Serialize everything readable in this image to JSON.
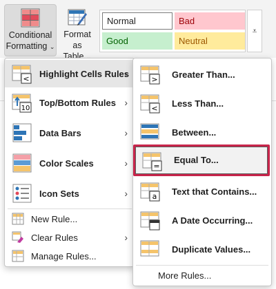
{
  "ribbon": {
    "conditional_formatting": {
      "line1": "Conditional",
      "line2": "Formatting",
      "caret": "⌄"
    },
    "format_as_table": {
      "line1": "Format as",
      "line2": "Table",
      "caret": "⌄"
    },
    "cell_styles": [
      {
        "label": "Normal",
        "kind": "normal"
      },
      {
        "label": "Bad",
        "kind": "bad"
      },
      {
        "label": "Good",
        "kind": "good"
      },
      {
        "label": "Neutral",
        "kind": "neutral"
      }
    ],
    "more_glyph": "⩡"
  },
  "menu": {
    "items": [
      {
        "label": "Highlight Cells Rules",
        "icon": "highlight-cells-icon",
        "bold": true,
        "arrow": "›"
      },
      {
        "label": "Top/Bottom Rules",
        "icon": "top-bottom-icon",
        "bold": true,
        "arrow": "›"
      },
      {
        "label": "Data Bars",
        "icon": "data-bars-icon",
        "bold": true,
        "arrow": "›"
      },
      {
        "label": "Color Scales",
        "icon": "color-scales-icon",
        "bold": true,
        "arrow": "›"
      },
      {
        "label": "Icon Sets",
        "icon": "icon-sets-icon",
        "bold": true,
        "arrow": "›"
      },
      {
        "label": "New Rule...",
        "icon": "new-rule-icon",
        "bold": false,
        "arrow": ""
      },
      {
        "label": "Clear Rules",
        "icon": "clear-rules-icon",
        "bold": false,
        "arrow": "›"
      },
      {
        "label": "Manage Rules...",
        "icon": "manage-rules-icon",
        "bold": false,
        "arrow": ""
      }
    ]
  },
  "submenu": {
    "items": [
      {
        "label": "Greater Than...",
        "icon": "greater-than-icon"
      },
      {
        "label": "Less Than...",
        "icon": "less-than-icon"
      },
      {
        "label": "Between...",
        "icon": "between-icon"
      },
      {
        "label": "Equal To...",
        "icon": "equal-to-icon"
      },
      {
        "label": "Text that Contains...",
        "icon": "text-contains-icon"
      },
      {
        "label": "A Date Occurring...",
        "icon": "date-occurring-icon"
      },
      {
        "label": "Duplicate Values...",
        "icon": "duplicate-values-icon"
      }
    ],
    "more_rules": "More Rules..."
  },
  "colors": {
    "accent_red": "#c8254b",
    "bad_fill": "#ffc7ce",
    "good_fill": "#c6efce",
    "neutral_fill": "#ffeb9c"
  }
}
